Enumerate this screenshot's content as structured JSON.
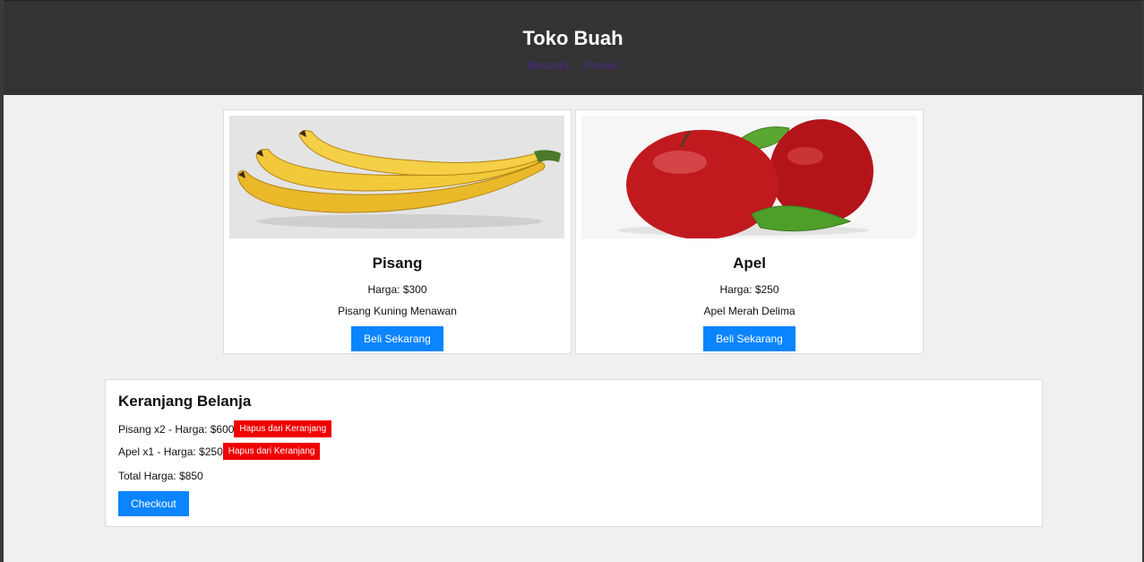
{
  "header": {
    "title": "Toko Buah",
    "nav": [
      "Beranda",
      "Produk"
    ]
  },
  "products": [
    {
      "name": "Pisang",
      "price": "Harga: $300",
      "description": "Pisang Kuning Menawan",
      "button": "Beli Sekarang"
    },
    {
      "name": "Apel",
      "price": "Harga: $250",
      "description": "Apel Merah Delima",
      "button": "Beli Sekarang"
    }
  ],
  "cart": {
    "title": "Keranjang Belanja",
    "items": [
      {
        "text": "Pisang x2 - Harga: $600",
        "remove_label": "Hapus dari Keranjang"
      },
      {
        "text": "Apel x1 - Harga: $250",
        "remove_label": "Hapus dari Keranjang"
      }
    ],
    "total": "Total Harga: $850",
    "checkout_label": "Checkout"
  },
  "colors": {
    "header_bg": "#333333",
    "accent_blue": "#0a84ff",
    "danger_red": "#f00000"
  }
}
